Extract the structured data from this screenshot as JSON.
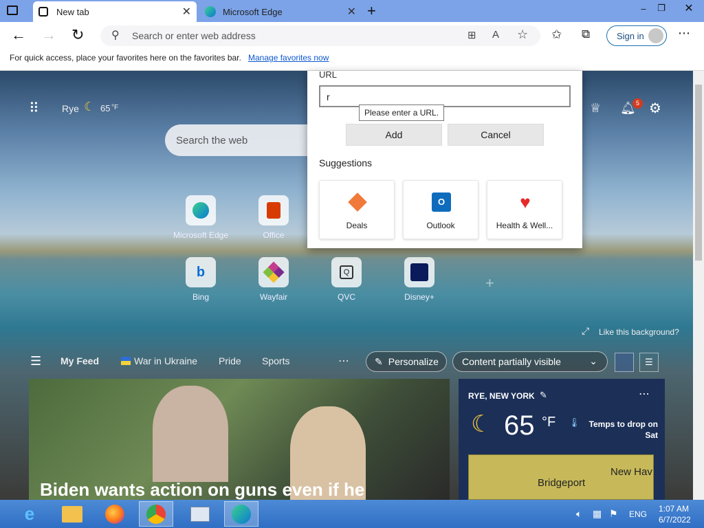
{
  "tabs": [
    {
      "label": "New tab",
      "active": true
    },
    {
      "label": "Microsoft Edge",
      "active": false
    }
  ],
  "toolbar": {
    "address_placeholder": "Search or enter web address",
    "sign_in": "Sign in"
  },
  "favbar": {
    "text": "For quick access, place your favorites here on the favorites bar.",
    "link": "Manage favorites now"
  },
  "newtab": {
    "location": "Rye",
    "temp": "65",
    "temp_unit": "°F",
    "search_placeholder": "Search the web",
    "quick_links": [
      {
        "label": "Microsoft Edge",
        "icon": "edge-icon"
      },
      {
        "label": "Office",
        "icon": "office-icon"
      },
      {
        "label": "Bing",
        "icon": "bing-icon"
      },
      {
        "label": "Wayfair",
        "icon": "wayfair-icon"
      },
      {
        "label": "QVC",
        "icon": "qvc-icon"
      },
      {
        "label": "Disney+",
        "icon": "disney-icon"
      }
    ],
    "notifications_count": "5",
    "like_background": "Like this background?",
    "feed_tabs": [
      "My Feed",
      "War in Ukraine",
      "Pride",
      "Sports"
    ],
    "personalize": "Personalize",
    "content_visibility": "Content partially visible",
    "headline": "Biden wants action on guns even if he"
  },
  "weather": {
    "location": "RYE, NEW YORK",
    "temp": "65",
    "unit": "°F",
    "note": "Temps to drop on Sat",
    "map_labels": [
      "Bridgeport",
      "New Hav"
    ]
  },
  "dialog": {
    "url_label": "URL",
    "url_value": "r",
    "tooltip": "Please enter a URL.",
    "add": "Add",
    "cancel": "Cancel",
    "suggestions_title": "Suggestions",
    "suggestions": [
      {
        "label": "Deals",
        "icon": "deals-icon"
      },
      {
        "label": "Outlook",
        "icon": "outlook-icon"
      },
      {
        "label": "Health & Well...",
        "icon": "heart-icon"
      }
    ]
  },
  "taskbar": {
    "lang": "ENG",
    "time": "1:07 AM",
    "date": "6/7/2022"
  },
  "colors": {
    "titlebar": "#7ca3e8",
    "link": "#0b57d0",
    "taskbar": "#3a78cc"
  }
}
